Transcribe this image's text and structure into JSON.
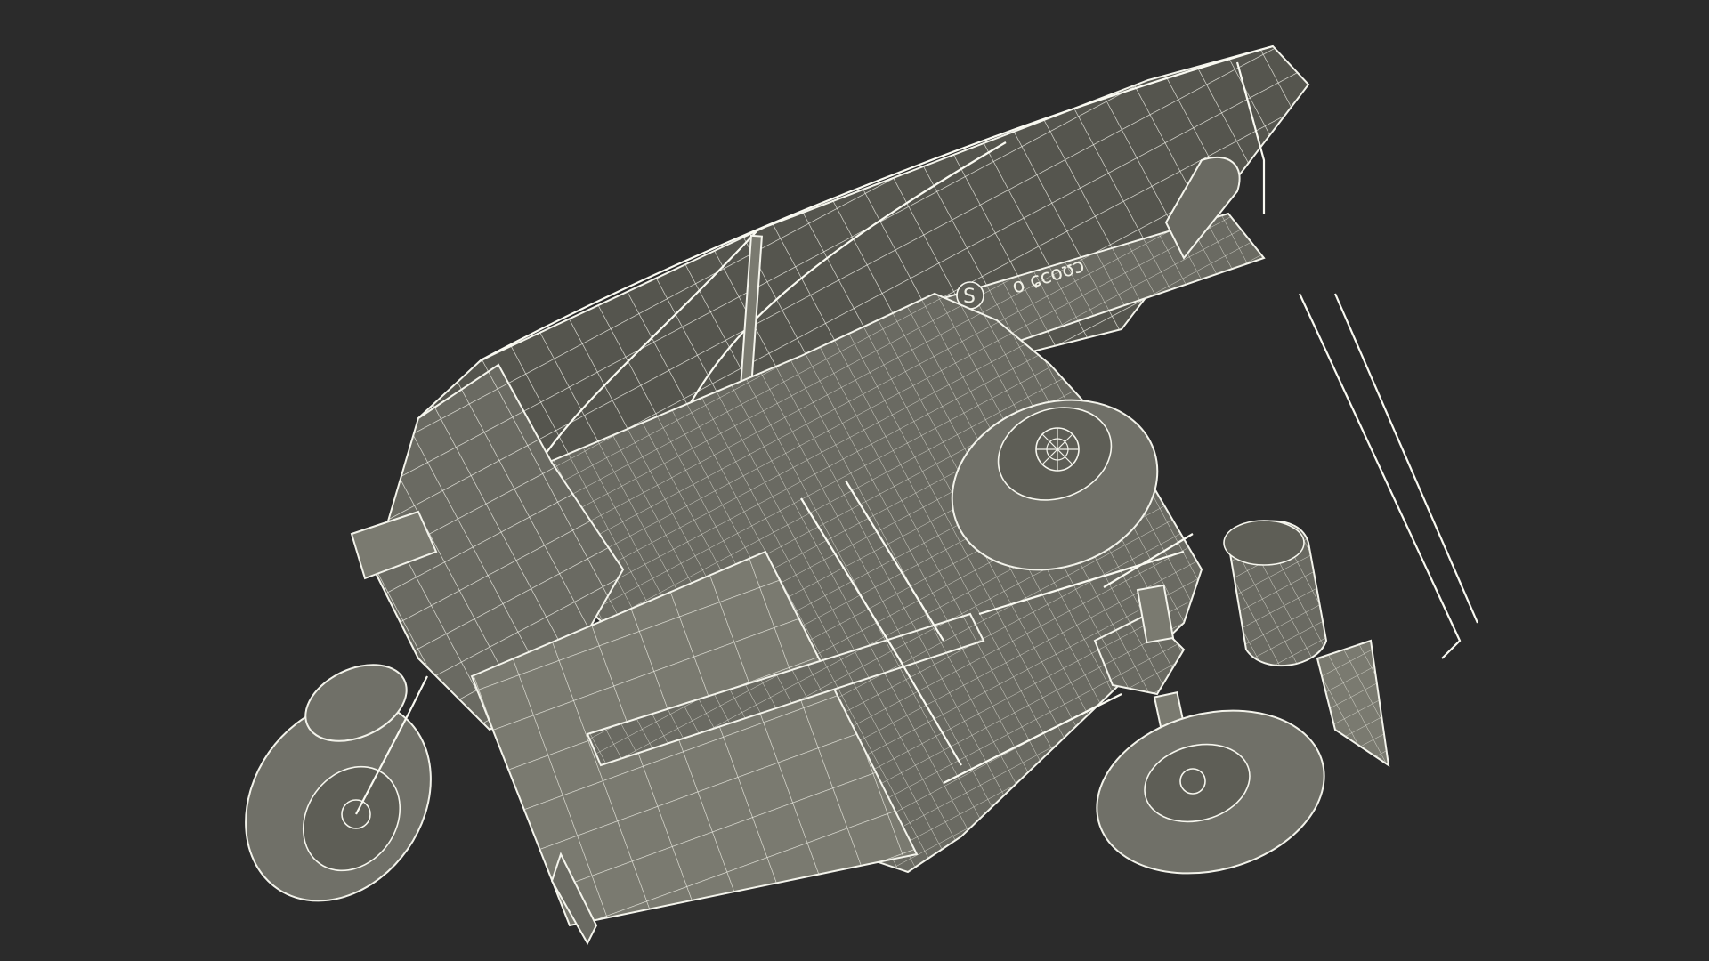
{
  "scene": {
    "background_color": "#2b2b2b",
    "wire_color": "#f2f2ea",
    "surface_color": "#6a6a62",
    "subject": "auto-rickshaw-wireframe-underside"
  },
  "model": {
    "emblem_letter": "S",
    "emblem_script": "o ɕcoʊɔ"
  }
}
